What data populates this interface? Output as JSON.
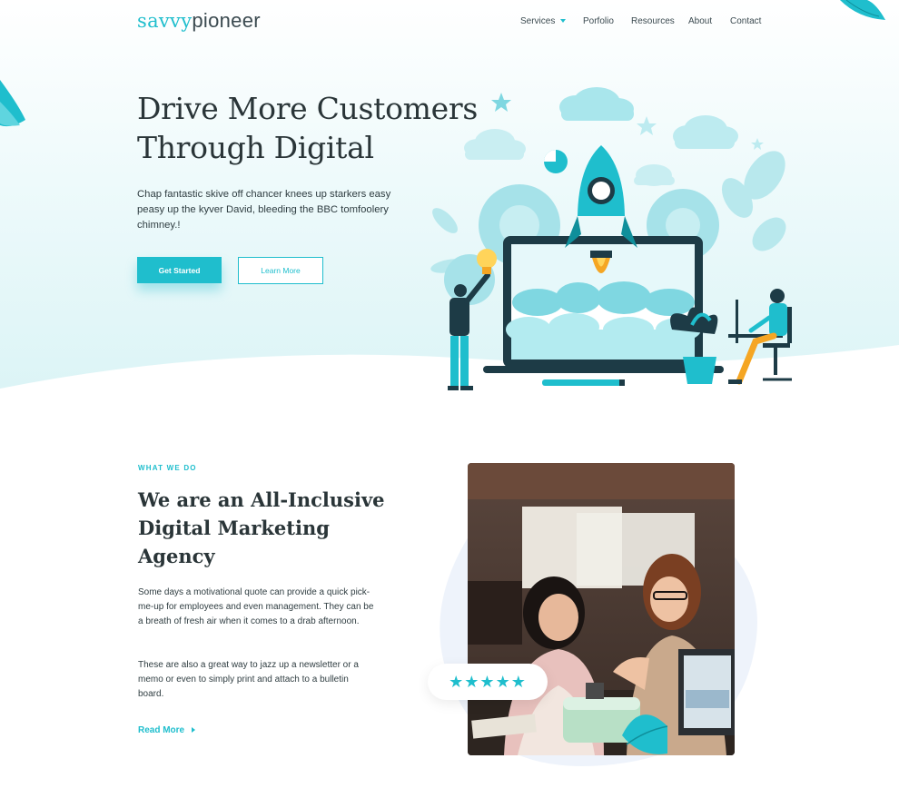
{
  "brand": {
    "part1": "savvy",
    "part2": "pioneer"
  },
  "nav": {
    "items": [
      {
        "label": "Services",
        "dropdown": true
      },
      {
        "label": "Porfolio"
      },
      {
        "label": "Resources"
      },
      {
        "label": "About"
      },
      {
        "label": "Contact"
      }
    ]
  },
  "hero": {
    "title_line1": "Drive More Customers",
    "title_line2": "Through Digital",
    "description": "Chap fantastic skive off chancer knees up starkers easy peasy up the kyver David, bleeding the BBC tomfoolery chimney.!",
    "primary_button": "Get Started",
    "secondary_button": "Learn More"
  },
  "about": {
    "eyebrow": "WHAT WE DO",
    "title": "We are an All-Inclusive Digital Marketing Agency",
    "paragraph1": "Some days a motivational quote can provide a quick pick-me-up for employees and even management. They can be a breath of fresh air when it comes to a drab afternoon.",
    "paragraph2": "These are also a great way to jazz up a newsletter or a memo or even to simply print and attach to a bulletin board.",
    "read_more": "Read More",
    "rating_stars": "★★★★★",
    "rating_value": 5
  },
  "colors": {
    "accent": "#1fbecd",
    "text": "#2a3538",
    "hero_bg": "#dbf4f6"
  },
  "icons": [
    "star-icon",
    "chevron-down-icon",
    "arrow-right-icon",
    "rocket-icon",
    "lightbulb-icon",
    "cloud-icon",
    "gear-icon"
  ]
}
